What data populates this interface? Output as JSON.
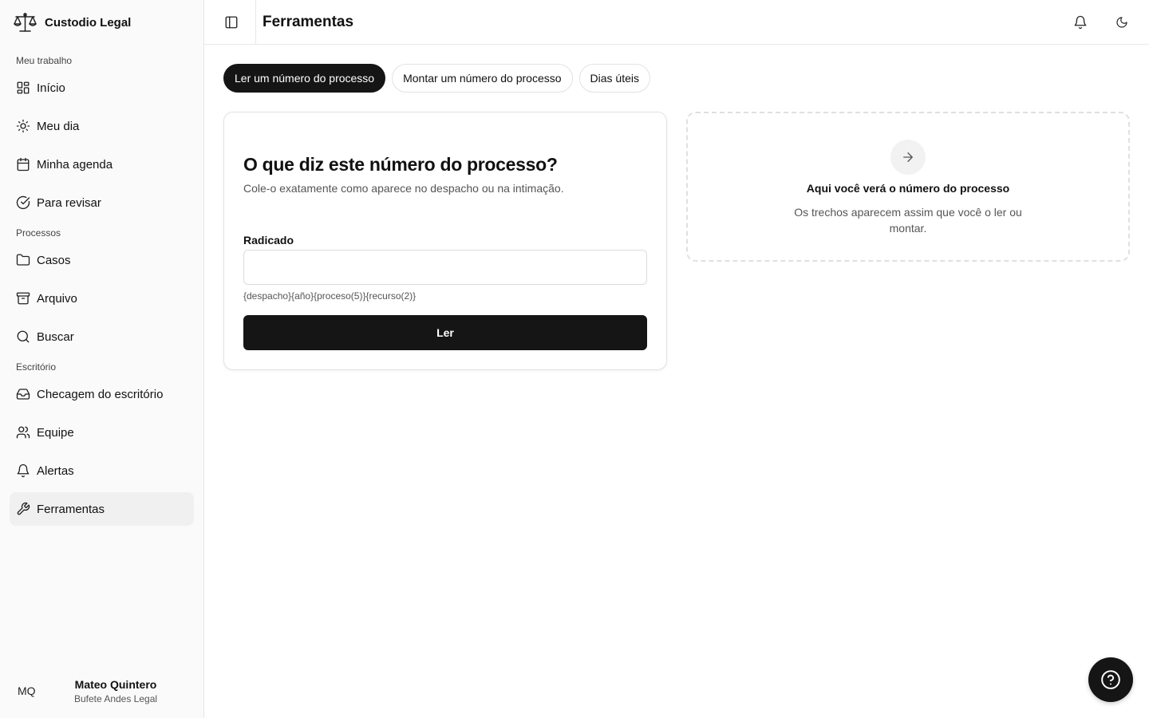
{
  "app": {
    "name": "Custodio Legal",
    "logo_icon": "scales-icon"
  },
  "sidebar": {
    "sections": [
      {
        "label": "Meu trabalho"
      },
      {
        "label": "Processos"
      },
      {
        "label": "Escritório"
      }
    ],
    "items": [
      {
        "label": "Início",
        "icon": "dashboard-icon"
      },
      {
        "label": "Meu dia",
        "icon": "sun-icon"
      },
      {
        "label": "Minha agenda",
        "icon": "calendar-icon"
      },
      {
        "label": "Para revisar",
        "icon": "check-circle-icon"
      },
      {
        "label": "Casos",
        "icon": "folder-icon"
      },
      {
        "label": "Arquivo",
        "icon": "archive-icon"
      },
      {
        "label": "Buscar",
        "icon": "search-icon"
      },
      {
        "label": "Checagem do escritório",
        "icon": "inbox-icon"
      },
      {
        "label": "Equipe",
        "icon": "users-icon"
      },
      {
        "label": "Alertas",
        "icon": "bell-icon"
      },
      {
        "label": "Ferramentas",
        "icon": "wrench-icon",
        "active": true
      }
    ],
    "user": {
      "initials": "MQ",
      "name": "Mateo Quintero",
      "org": "Bufete Andes Legal"
    }
  },
  "header": {
    "title": "Ferramentas"
  },
  "tabs": [
    {
      "label": "Ler um número do processo",
      "active": true
    },
    {
      "label": "Montar um número do processo",
      "active": false
    },
    {
      "label": "Dias úteis",
      "active": false
    }
  ],
  "form": {
    "title": "O que diz este número do processo?",
    "subtitle": "Cole-o exatamente como aparece no despacho ou na intimação.",
    "field_label": "Radicado",
    "field_value": "",
    "field_placeholder": "",
    "hint": "{despacho}{año}{proceso(5)}{recurso(2)}",
    "submit_label": "Ler"
  },
  "result_panel": {
    "title": "Aqui você verá o número do processo",
    "text": "Os trechos aparecem assim que você o ler ou montar."
  },
  "colors": {
    "primary": "#151515",
    "sidebar_bg": "#fafafa",
    "active_item_bg": "#f0f0f0"
  }
}
